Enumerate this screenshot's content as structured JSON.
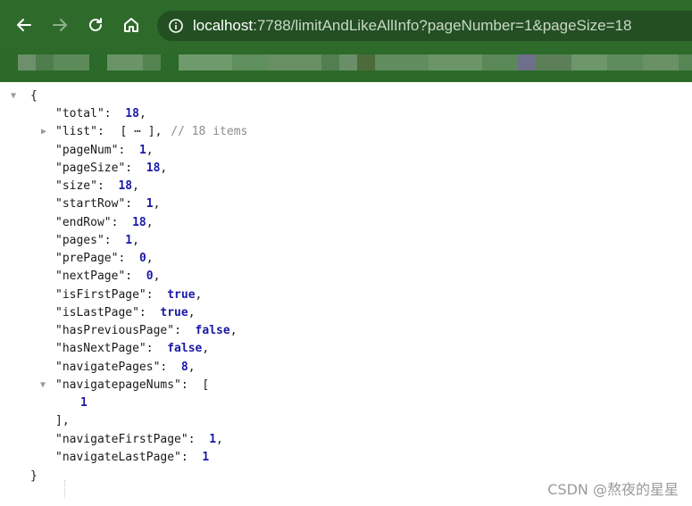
{
  "browser": {
    "back_icon": "arrow-left-icon",
    "forward_icon": "arrow-right-icon",
    "reload_icon": "reload-icon",
    "home_icon": "home-icon",
    "info_icon": "info-circle-icon",
    "url_host": "localhost",
    "url_rest": ":7788/limitAndLikeAllInfo?pageNumber=1&pageSize=18"
  },
  "json_view": {
    "open_brace": "{",
    "close_brace": "}",
    "lines": [
      {
        "key": "\"total\"",
        "value": "18",
        "kind": "num"
      },
      {
        "key": "\"list\"",
        "value": "[ ⋯ ],",
        "comment": "// 18 items",
        "kind": "collapsed"
      },
      {
        "key": "\"pageNum\"",
        "value": "1",
        "kind": "num"
      },
      {
        "key": "\"pageSize\"",
        "value": "18",
        "kind": "num"
      },
      {
        "key": "\"size\"",
        "value": "18",
        "kind": "num"
      },
      {
        "key": "\"startRow\"",
        "value": "1",
        "kind": "num"
      },
      {
        "key": "\"endRow\"",
        "value": "18",
        "kind": "num"
      },
      {
        "key": "\"pages\"",
        "value": "1",
        "kind": "num"
      },
      {
        "key": "\"prePage\"",
        "value": "0",
        "kind": "num"
      },
      {
        "key": "\"nextPage\"",
        "value": "0",
        "kind": "num"
      },
      {
        "key": "\"isFirstPage\"",
        "value": "true",
        "kind": "bool"
      },
      {
        "key": "\"isLastPage\"",
        "value": "true",
        "kind": "bool"
      },
      {
        "key": "\"hasPreviousPage\"",
        "value": "false",
        "kind": "bool"
      },
      {
        "key": "\"hasNextPage\"",
        "value": "false",
        "kind": "bool"
      },
      {
        "key": "\"navigatePages\"",
        "value": "8",
        "kind": "num"
      },
      {
        "key": "\"navigatepageNums\"",
        "value": "[",
        "kind": "open"
      },
      {
        "value": "1",
        "kind": "item"
      },
      {
        "value": "],",
        "kind": "close"
      },
      {
        "key": "\"navigateFirstPage\"",
        "value": "1",
        "kind": "num"
      },
      {
        "key": "\"navigateLastPage\"",
        "value": "1",
        "kind": "num",
        "last": true
      }
    ]
  },
  "watermark": "CSDN @熬夜的星星",
  "colors": {
    "titlebar": "#2e6b2b",
    "addressbar": "#234f22",
    "number": "#1a1aa6",
    "comment": "#8b8b8b"
  }
}
